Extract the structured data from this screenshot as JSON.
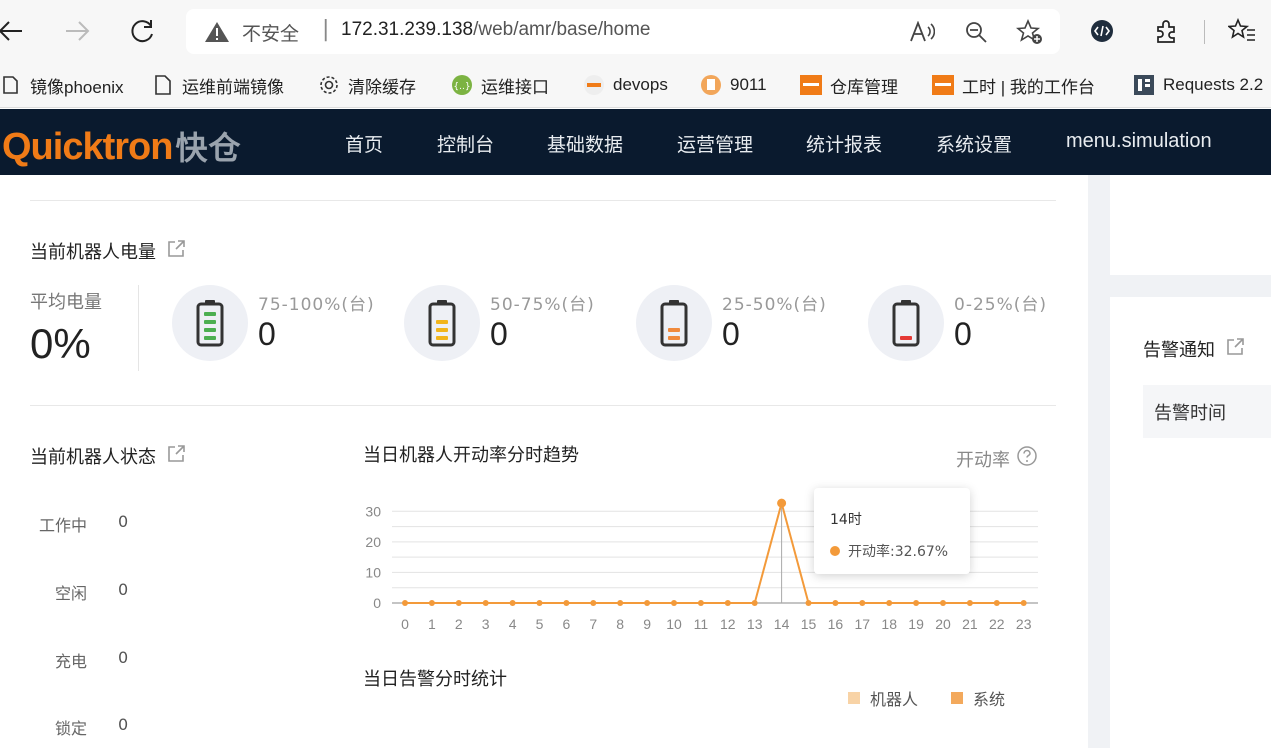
{
  "browser": {
    "security_label": "不安全",
    "url_host": "172.31.239.138",
    "url_path": "/web/amr/base/home",
    "bookmarks": [
      {
        "label": "镜像phoenix",
        "icon": "folder-icon"
      },
      {
        "label": "运维前端镜像",
        "icon": "page-icon"
      },
      {
        "label": "清除缓存",
        "icon": "gear-icon"
      },
      {
        "label": "运维接口",
        "icon": "api-icon"
      },
      {
        "label": "devops",
        "icon": "quicktron-icon"
      },
      {
        "label": "9011",
        "icon": "doc-icon"
      },
      {
        "label": "仓库管理",
        "icon": "quicktron-icon"
      },
      {
        "label": "工时 | 我的工作台",
        "icon": "quicktron-icon"
      },
      {
        "label": "Requests 2.2",
        "icon": "book-icon"
      }
    ]
  },
  "app": {
    "logo_text": "Quicktron",
    "logo_cn": "快仓",
    "nav": [
      "首页",
      "控制台",
      "基础数据",
      "运营管理",
      "统计报表",
      "系统设置",
      "menu.simulation"
    ]
  },
  "battery": {
    "title": "当前机器人电量",
    "avg_label": "平均电量",
    "avg_value": "0%",
    "groups": [
      {
        "range": "75-100%(台)",
        "count": "0",
        "color": "#4caf50",
        "level_bars": 4
      },
      {
        "range": "50-75%(台)",
        "count": "0",
        "color": "#f2b51b",
        "level_bars": 3
      },
      {
        "range": "25-50%(台)",
        "count": "0",
        "color": "#f08a3c",
        "level_bars": 2
      },
      {
        "range": "0-25%(台)",
        "count": "0",
        "color": "#e53935",
        "level_bars": 1
      }
    ]
  },
  "robot_status": {
    "title": "当前机器人状态",
    "items": [
      {
        "label": "工作中",
        "value": "0"
      },
      {
        "label": "空闲",
        "value": "0"
      },
      {
        "label": "充电",
        "value": "0"
      },
      {
        "label": "锁定",
        "value": "0"
      }
    ]
  },
  "trend": {
    "title": "当日机器人开动率分时趋势",
    "rate_label": "开动率",
    "tooltip_title": "14时",
    "tooltip_text": "开动率:32.67%"
  },
  "alarm_stats": {
    "title": "当日告警分时统计",
    "legend": [
      {
        "name": "机器人",
        "color": "#f8d3a6"
      },
      {
        "name": "系统",
        "color": "#f3a95c"
      }
    ]
  },
  "notice": {
    "title": "告警通知",
    "col_time": "告警时间"
  },
  "colors": {
    "nav_bg": "#0a1a2e",
    "accent": "#f07b17",
    "line": "#f39a3a"
  },
  "chart_data": {
    "type": "line",
    "title": "当日机器人开动率分时趋势",
    "x": [
      "0",
      "1",
      "2",
      "3",
      "4",
      "5",
      "6",
      "7",
      "8",
      "9",
      "10",
      "11",
      "12",
      "13",
      "14",
      "15",
      "16",
      "17",
      "18",
      "19",
      "20",
      "21",
      "22",
      "23"
    ],
    "series": [
      {
        "name": "开动率",
        "values": [
          0,
          0,
          0,
          0,
          0,
          0,
          0,
          0,
          0,
          0,
          0,
          0,
          0,
          0,
          32.67,
          0,
          0,
          0,
          0,
          0,
          0,
          0,
          0,
          0
        ]
      }
    ],
    "yticks": [
      "0",
      "10",
      "20",
      "30"
    ],
    "ylim": [
      0,
      35
    ],
    "grid": true
  }
}
